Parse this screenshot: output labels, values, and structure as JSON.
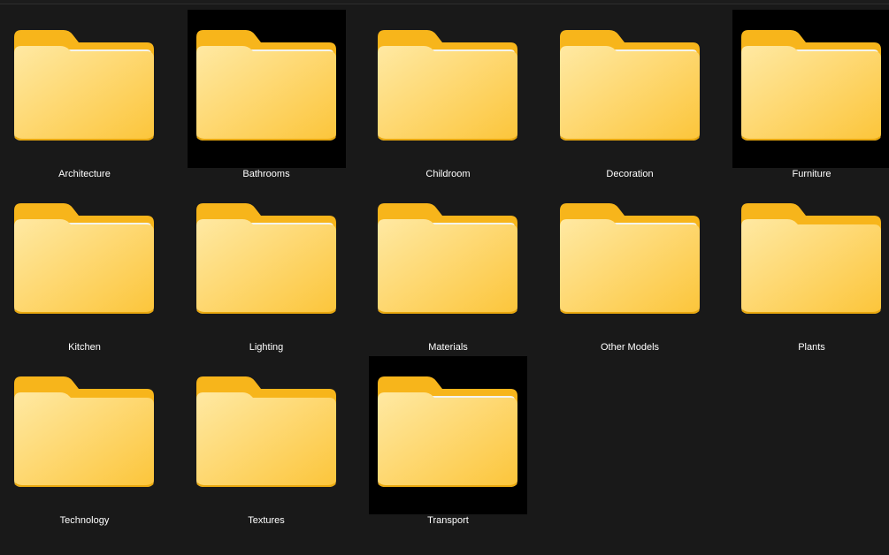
{
  "folders": [
    {
      "name": "Architecture",
      "dark_bg": false,
      "paper": true
    },
    {
      "name": "Bathrooms",
      "dark_bg": true,
      "paper": true
    },
    {
      "name": "Childroom",
      "dark_bg": false,
      "paper": true
    },
    {
      "name": "Decoration",
      "dark_bg": false,
      "paper": true
    },
    {
      "name": "Furniture",
      "dark_bg": true,
      "paper": true
    },
    {
      "name": "Kitchen",
      "dark_bg": false,
      "paper": true
    },
    {
      "name": "Lighting",
      "dark_bg": false,
      "paper": true
    },
    {
      "name": "Materials",
      "dark_bg": false,
      "paper": true
    },
    {
      "name": "Other Models",
      "dark_bg": false,
      "paper": true
    },
    {
      "name": "Plants",
      "dark_bg": false,
      "paper": false
    },
    {
      "name": "Technology",
      "dark_bg": false,
      "paper": false
    },
    {
      "name": "Textures",
      "dark_bg": false,
      "paper": false
    },
    {
      "name": "Transport",
      "dark_bg": true,
      "paper": true
    }
  ],
  "colors": {
    "background": "#191919",
    "label_text": "#ffffff",
    "folder_back": "#f7b51b",
    "folder_front_light": "#ffe9a3",
    "folder_front_dark": "#fcc53a",
    "thumb_dark": "#000000"
  },
  "icons": {
    "folder": "folder-icon"
  }
}
